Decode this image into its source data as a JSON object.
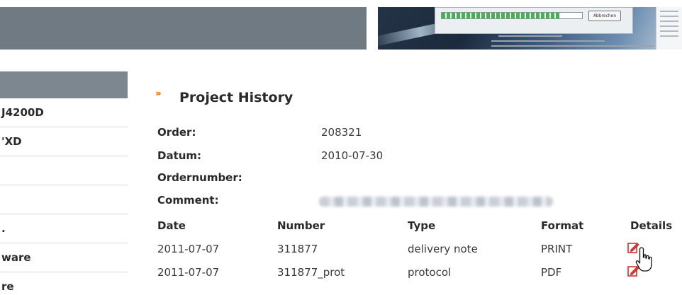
{
  "header": {
    "screenshot_dialog": {
      "cancel_label": "Abbrechen",
      "progress": 0.85
    }
  },
  "sidebar": {
    "items": [
      {
        "label": "J4200D"
      },
      {
        "label": "'XD"
      },
      {
        "label": ""
      },
      {
        "label": ""
      },
      {
        "label": "."
      },
      {
        "label": "ware"
      },
      {
        "label": "re"
      }
    ]
  },
  "main": {
    "title": "Project History",
    "title_icon": "double-chevron-right-icon",
    "info": {
      "order_label": "Order:",
      "order_value": "208321",
      "datum_label": "Datum:",
      "datum_value": "2010-07-30",
      "ordernumber_label": "Ordernumber:",
      "ordernumber_value": "",
      "comment_label": "Comment:"
    },
    "table": {
      "headers": [
        "Date",
        "Number",
        "Type",
        "Format",
        "Details"
      ],
      "rows": [
        {
          "date": "2011-07-07",
          "number": "311877",
          "type": "delivery note",
          "format": "PRINT",
          "details_icon": "edit-document-icon"
        },
        {
          "date": "2011-07-07",
          "number": "311877_prot",
          "type": "protocol",
          "format": "PDF",
          "details_icon": "edit-document-icon"
        }
      ]
    }
  },
  "colors": {
    "accent": "#ee7d23",
    "header_bar": "#6f7a83",
    "sidebar_header": "#7d8790",
    "details_icon": "#d32f2f"
  }
}
